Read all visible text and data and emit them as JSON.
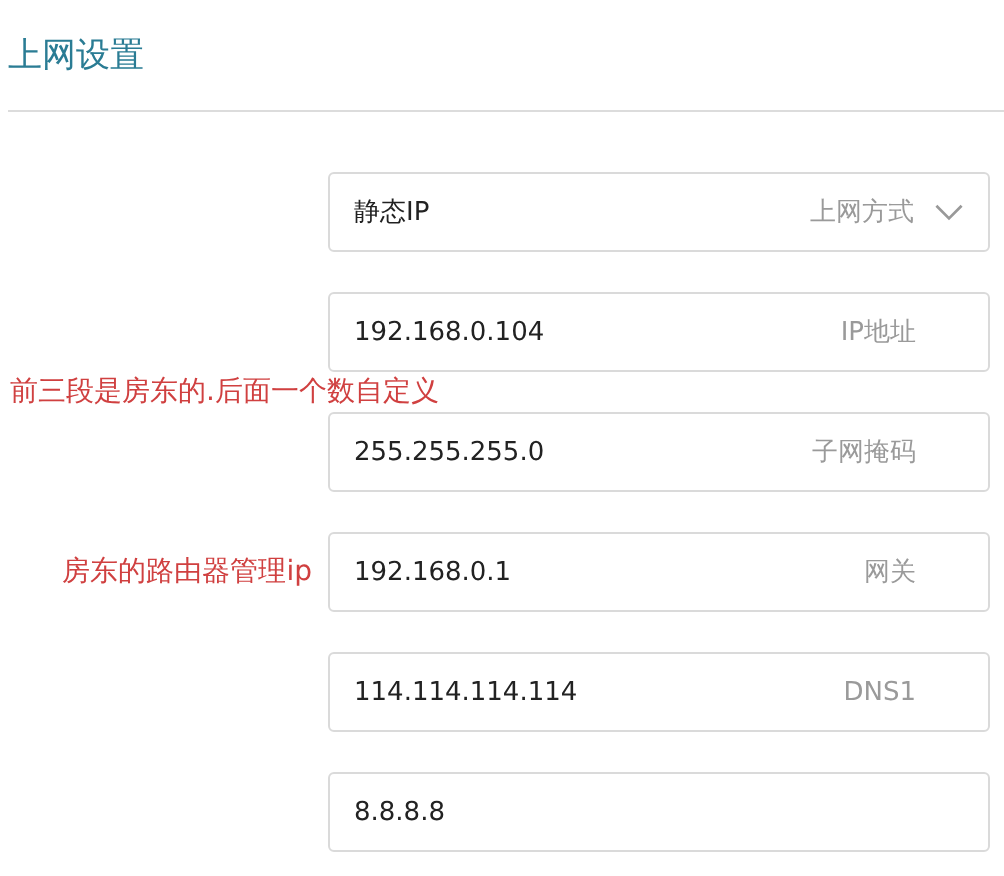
{
  "title": "上网设置",
  "fields": [
    {
      "kind": "select",
      "value": "静态IP",
      "hint": "上网方式"
    },
    {
      "kind": "text",
      "value": "192.168.0.104",
      "hint": "IP地址",
      "note": {
        "kind": "overlay",
        "text": "前三段是房东的.后面一个数自定义"
      }
    },
    {
      "kind": "text",
      "value": "255.255.255.0",
      "hint": "子网掩码"
    },
    {
      "kind": "text",
      "value": "192.168.0.1",
      "hint": "网关",
      "note": {
        "kind": "side",
        "text": "房东的路由器管理ip"
      }
    },
    {
      "kind": "text",
      "value": "114.114.114.114",
      "hint": "DNS1"
    },
    {
      "kind": "text",
      "value": "8.8.8.8"
    }
  ]
}
